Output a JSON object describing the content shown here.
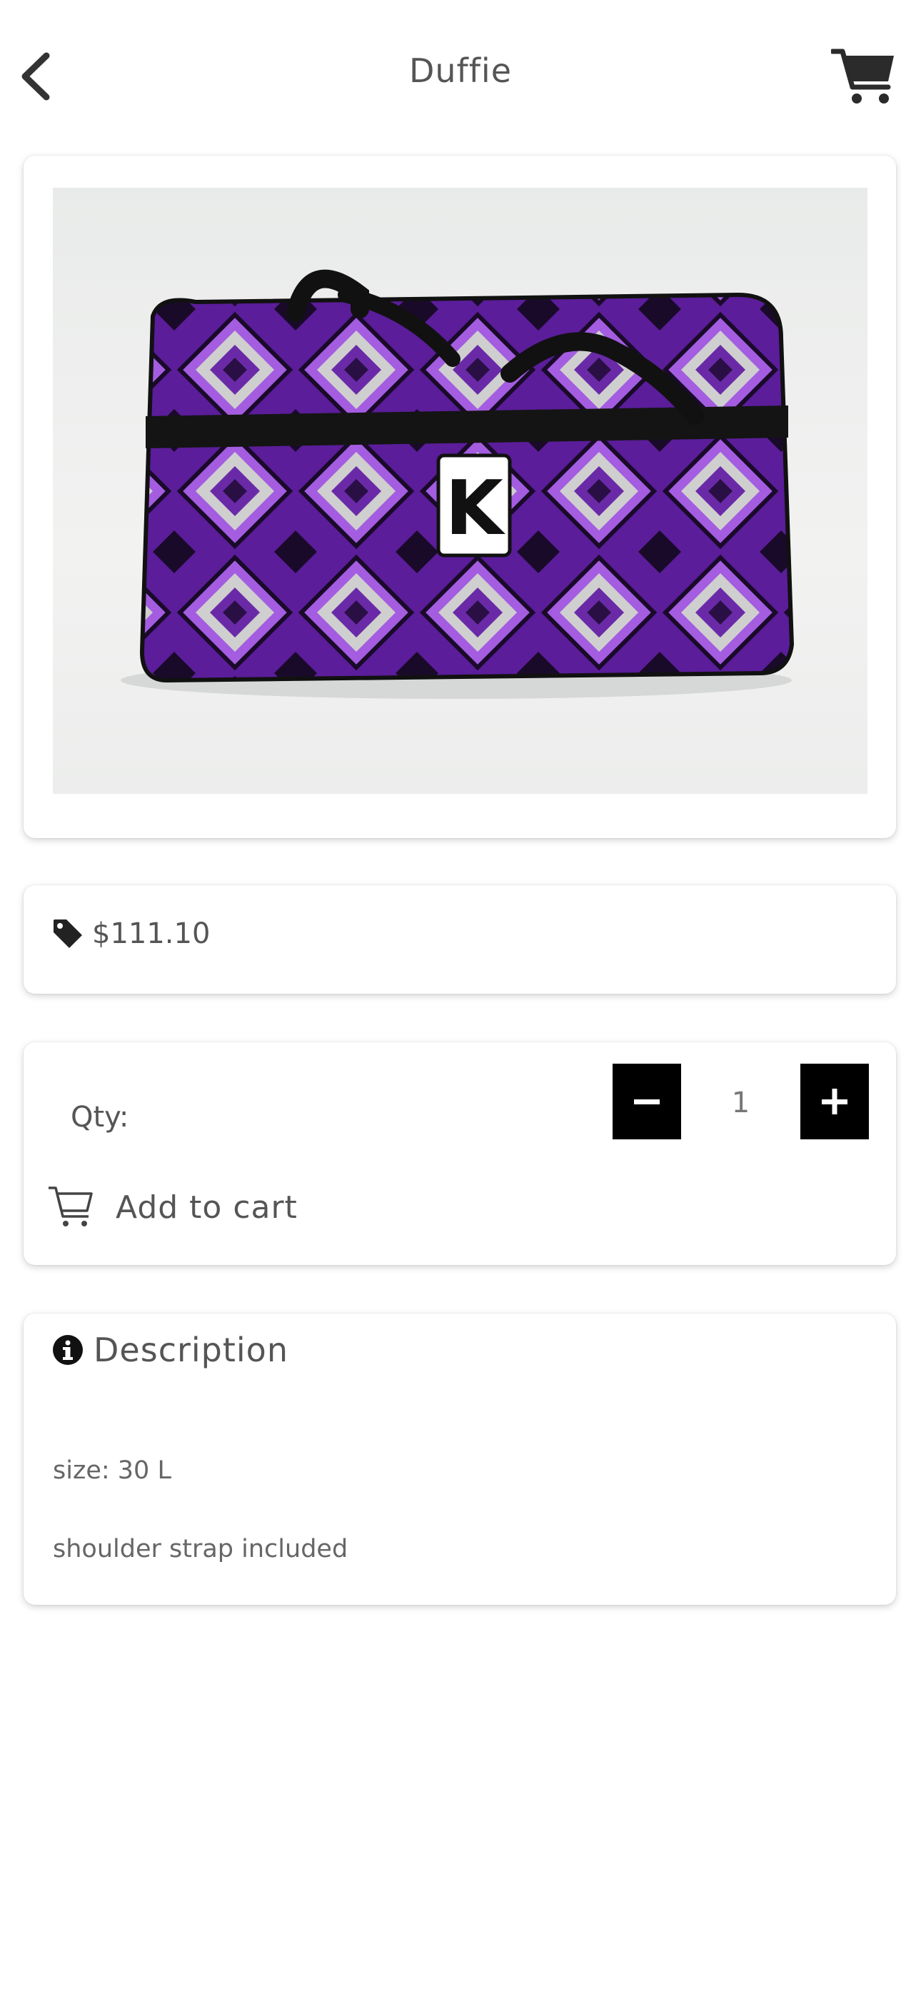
{
  "header": {
    "title": "Duffie",
    "back_icon": "chevron-left-icon",
    "cart_icon": "shopping-cart-icon"
  },
  "product_image": {
    "logo_letter": "K",
    "colors": {
      "purple": "#5b1d9a",
      "light_purple": "#a45ce0",
      "black": "#111111"
    }
  },
  "price": {
    "icon": "tag-icon",
    "value": "$111.10"
  },
  "quantity": {
    "label": "Qty:",
    "value": "1",
    "decrement_icon": "minus-icon",
    "increment_icon": "plus-icon"
  },
  "add_to_cart": {
    "icon": "cart-outline-icon",
    "label": "Add to cart"
  },
  "description": {
    "icon": "info-circle-icon",
    "title": "Description",
    "lines": [
      "size: 30 L",
      "shoulder strap included"
    ]
  }
}
